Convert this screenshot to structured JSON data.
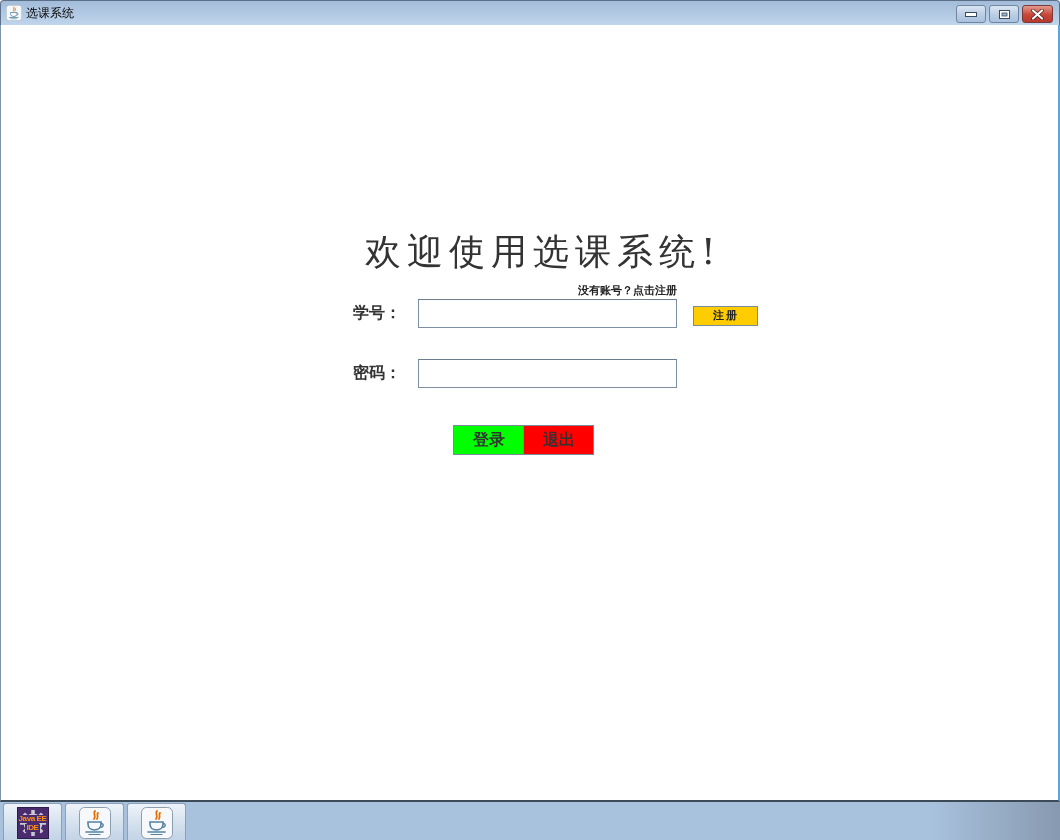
{
  "window": {
    "title": "选课系统",
    "controls": [
      {
        "kind": "minimize"
      },
      {
        "kind": "maximize"
      },
      {
        "kind": "close"
      }
    ]
  },
  "login": {
    "heading": "欢迎使用选课系统!",
    "register_hint": "没有账号？点击注册",
    "fields": [
      {
        "label": "学号："
      },
      {
        "label": "密码："
      }
    ],
    "register_button": "注册",
    "actions": [
      {
        "label": "登录",
        "color": "#00ff00"
      },
      {
        "label": "退出",
        "color": "#ff0000"
      }
    ]
  },
  "taskbar": {
    "items": [
      {
        "kind": "ide",
        "logo_text": [
          "Java EE",
          "IDE"
        ]
      },
      {
        "kind": "java"
      },
      {
        "kind": "java"
      }
    ]
  }
}
